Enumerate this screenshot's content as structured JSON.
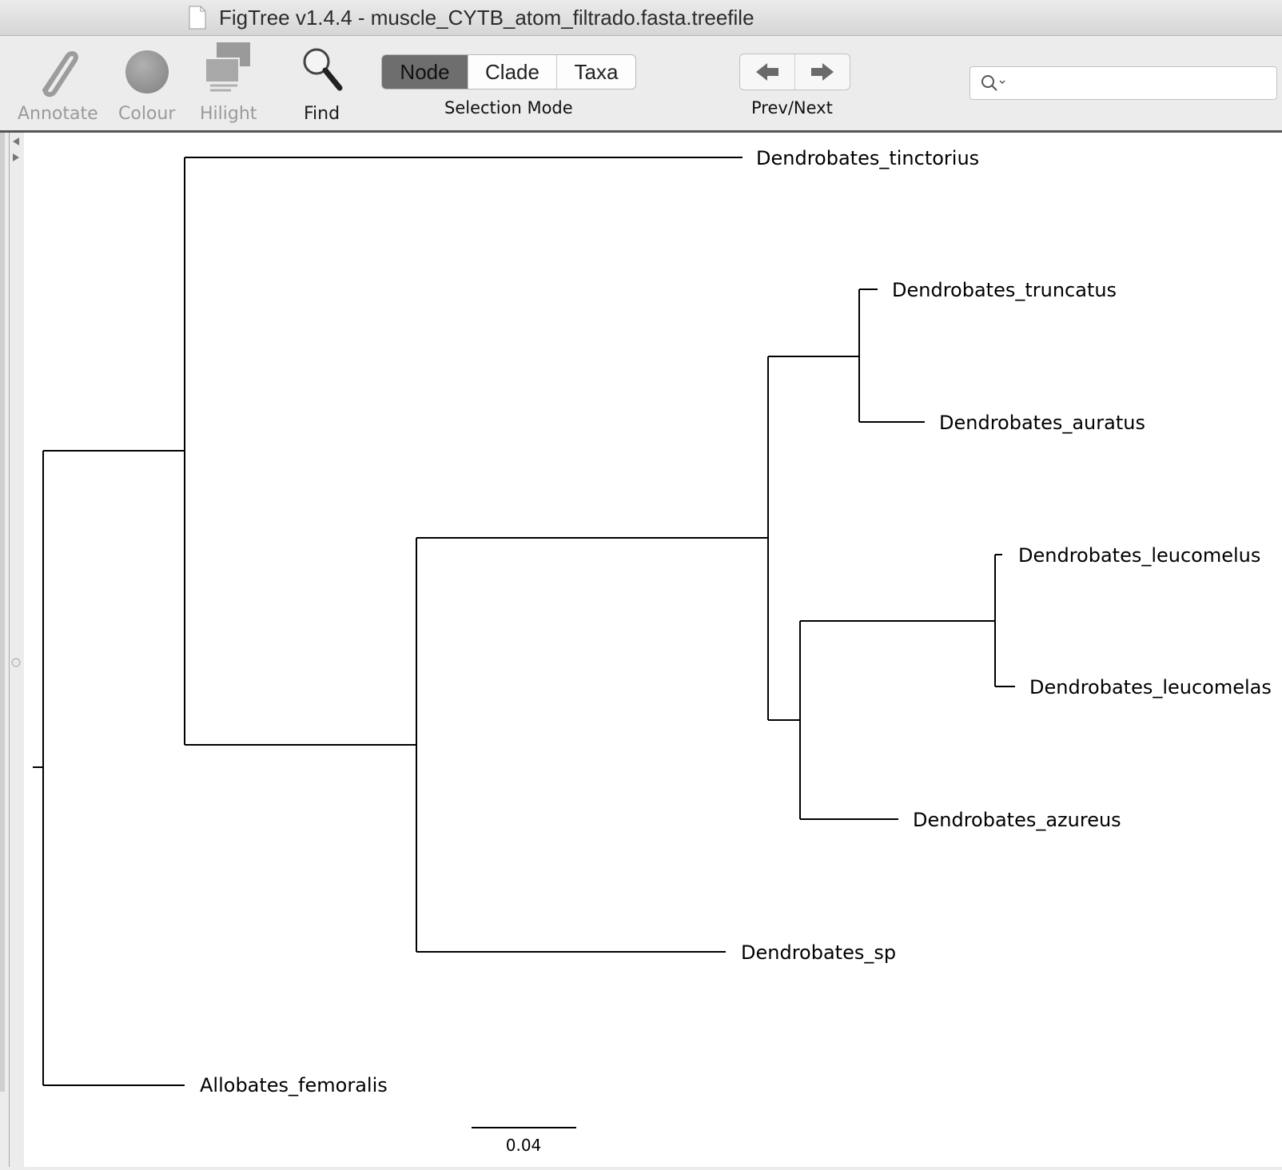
{
  "window": {
    "title": "FigTree v1.4.4 - muscle_CYTB_atom_filtrado.fasta.treefile"
  },
  "toolbar": {
    "tools": [
      {
        "label": "Annotate",
        "icon": "paperclip-icon",
        "enabled": false
      },
      {
        "label": "Colour",
        "icon": "color-circle-icon",
        "enabled": false
      },
      {
        "label": "Hilight",
        "icon": "hilight-icon",
        "enabled": false
      },
      {
        "label": "Find",
        "icon": "magnifier-icon",
        "enabled": true
      }
    ],
    "selection_mode": {
      "options": [
        "Node",
        "Clade",
        "Taxa"
      ],
      "selected": "Node",
      "caption": "Selection Mode"
    },
    "prev_next": {
      "caption": "Prev/Next",
      "prev_icon": "arrow-left-icon",
      "next_icon": "arrow-right-icon"
    },
    "search": {
      "value": "",
      "placeholder": ""
    }
  },
  "tree": {
    "taxa": [
      "Dendrobates_tinctorius",
      "Dendrobates_truncatus",
      "Dendrobates_auratus",
      "Dendrobates_leucomelus",
      "Dendrobates_leucomelas",
      "Dendrobates_azureus",
      "Dendrobates_sp",
      "Allobates_femoralis"
    ],
    "scale_bar_label": "0.04",
    "line_color": "#000000"
  }
}
